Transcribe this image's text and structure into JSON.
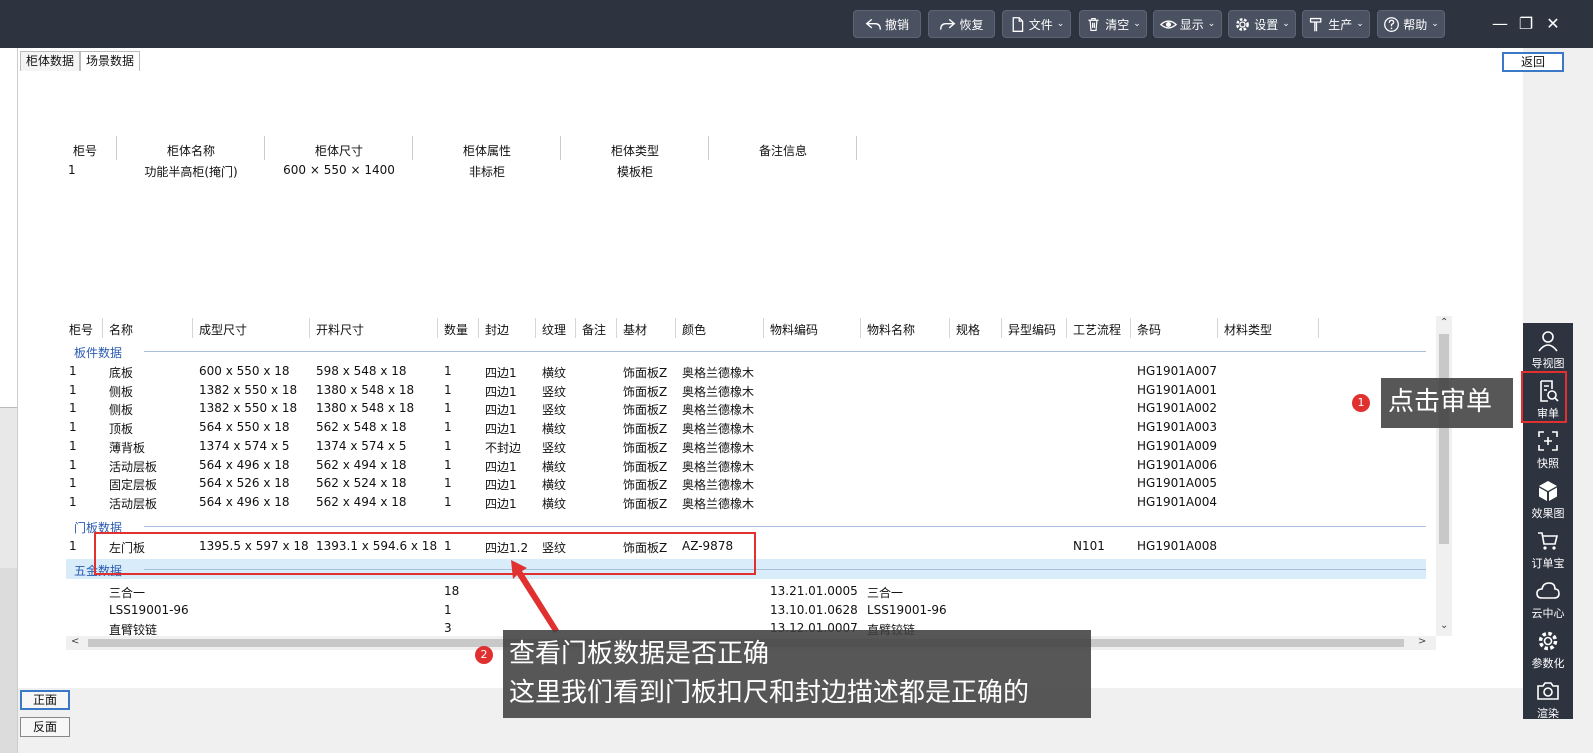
{
  "toolbar": {
    "buttons": [
      {
        "label": "撤销",
        "icon": "undo-icon"
      },
      {
        "label": "恢复",
        "icon": "redo-icon"
      },
      {
        "label": "文件",
        "icon": "file-icon"
      },
      {
        "label": "清空",
        "icon": "trash-icon"
      },
      {
        "label": "显示",
        "icon": "eye-icon"
      },
      {
        "label": "设置",
        "icon": "gear-icon"
      },
      {
        "label": "生产",
        "icon": "hammer-icon"
      },
      {
        "label": "帮助",
        "icon": "help-icon"
      }
    ],
    "window_controls": [
      "minimize-icon",
      "restore-icon",
      "close-icon"
    ]
  },
  "tabs": [
    "柜体数据",
    "场景数据"
  ],
  "back_label": "返回",
  "cabinet": {
    "headers": [
      "柜号",
      "柜体名称",
      "柜体尺寸",
      "柜体属性",
      "柜体类型",
      "备注信息"
    ],
    "row": [
      "1",
      "功能半高柜(掩门)",
      "600 × 550 × 1400",
      "非标柜",
      "模板柜",
      ""
    ]
  },
  "grid": {
    "headers": [
      "柜号",
      "名称",
      "成型尺寸",
      "开料尺寸",
      "数量",
      "封边",
      "纹理",
      "备注",
      "基材",
      "颜色",
      "物料编码",
      "物料名称",
      "规格",
      "异型编码",
      "工艺流程",
      "条码",
      "材料类型"
    ],
    "sections": {
      "panels": "板件数据",
      "doors": "门板数据",
      "hardware": "五金数据"
    },
    "panel_rows": [
      [
        "1",
        "底板",
        "600 x 550 x 18",
        "598 x 548 x 18",
        "1",
        "四边1",
        "横纹",
        "",
        "饰面板Z",
        "奥格兰德橡木",
        "",
        "",
        "",
        "",
        "",
        "HG1901A007"
      ],
      [
        "1",
        "侧板",
        "1382 x 550 x 18",
        "1380 x 548 x 18",
        "1",
        "四边1",
        "竖纹",
        "",
        "饰面板Z",
        "奥格兰德橡木",
        "",
        "",
        "",
        "",
        "",
        "HG1901A001"
      ],
      [
        "1",
        "侧板",
        "1382 x 550 x 18",
        "1380 x 548 x 18",
        "1",
        "四边1",
        "竖纹",
        "",
        "饰面板Z",
        "奥格兰德橡木",
        "",
        "",
        "",
        "",
        "",
        "HG1901A002"
      ],
      [
        "1",
        "顶板",
        "564 x 550 x 18",
        "562 x 548 x 18",
        "1",
        "四边1",
        "横纹",
        "",
        "饰面板Z",
        "奥格兰德橡木",
        "",
        "",
        "",
        "",
        "",
        "HG1901A003"
      ],
      [
        "1",
        "薄背板",
        "1374 x 574 x 5",
        "1374 x 574 x 5",
        "1",
        "不封边",
        "竖纹",
        "",
        "饰面板Z",
        "奥格兰德橡木",
        "",
        "",
        "",
        "",
        "",
        "HG1901A009"
      ],
      [
        "1",
        "活动层板",
        "564 x 496 x 18",
        "562 x 494 x 18",
        "1",
        "四边1",
        "横纹",
        "",
        "饰面板Z",
        "奥格兰德橡木",
        "",
        "",
        "",
        "",
        "",
        "HG1901A006"
      ],
      [
        "1",
        "固定层板",
        "564 x 526 x 18",
        "562 x 524 x 18",
        "1",
        "四边1",
        "横纹",
        "",
        "饰面板Z",
        "奥格兰德橡木",
        "",
        "",
        "",
        "",
        "",
        "HG1901A005"
      ],
      [
        "1",
        "活动层板",
        "564 x 496 x 18",
        "562 x 494 x 18",
        "1",
        "四边1",
        "横纹",
        "",
        "饰面板Z",
        "奥格兰德橡木",
        "",
        "",
        "",
        "",
        "",
        "HG1901A004"
      ]
    ],
    "door_rows": [
      [
        "1",
        "左门板",
        "1395.5 x 597 x 18",
        "1393.1 x 594.6 x 18",
        "1",
        "四边1.2",
        "竖纹",
        "",
        "饰面板Z",
        "AZ-9878",
        "",
        "",
        "",
        "",
        "N101",
        "HG1901A008"
      ]
    ],
    "hardware_rows": [
      [
        "",
        "三合一",
        "",
        "",
        "18",
        "",
        "",
        "",
        "",
        "",
        "13.21.01.0005",
        "三合一",
        "",
        "",
        "",
        ""
      ],
      [
        "",
        "LSS19001-96",
        "",
        "",
        "1",
        "",
        "",
        "",
        "",
        "",
        "13.10.01.0628",
        "LSS19001-96",
        "",
        "",
        "",
        ""
      ],
      [
        "",
        "直臂铰链",
        "",
        "",
        "3",
        "",
        "",
        "",
        "",
        "",
        "13.12.01.0007",
        "直臂铰链",
        "",
        "",
        "",
        ""
      ]
    ]
  },
  "bottom_buttons": [
    "正面",
    "反面"
  ],
  "right_sidebar": [
    {
      "label": "导视图",
      "icon": "person-icon"
    },
    {
      "label": "审单",
      "icon": "review-icon"
    },
    {
      "label": "快照",
      "icon": "snapshot-icon"
    },
    {
      "label": "效果图",
      "icon": "cube-icon"
    },
    {
      "label": "订单宝",
      "icon": "cart-icon"
    },
    {
      "label": "云中心",
      "icon": "cloud-icon"
    },
    {
      "label": "参数化",
      "icon": "gear-icon"
    },
    {
      "label": "渲染",
      "icon": "camera-icon"
    }
  ],
  "annotations": {
    "step1_number": "1",
    "step1_text": "点击审单",
    "step2_number": "2",
    "step2_line1": "查看门板数据是否正确",
    "step2_line2": "这里我们看到门板扣尺和封边描述都是正确的"
  },
  "colors": {
    "toolbar_bg": "#2e3340",
    "section_label": "#2a5bb0",
    "highlight_red": "#e03030",
    "hardware_row_bg": "#d9ecf9"
  }
}
